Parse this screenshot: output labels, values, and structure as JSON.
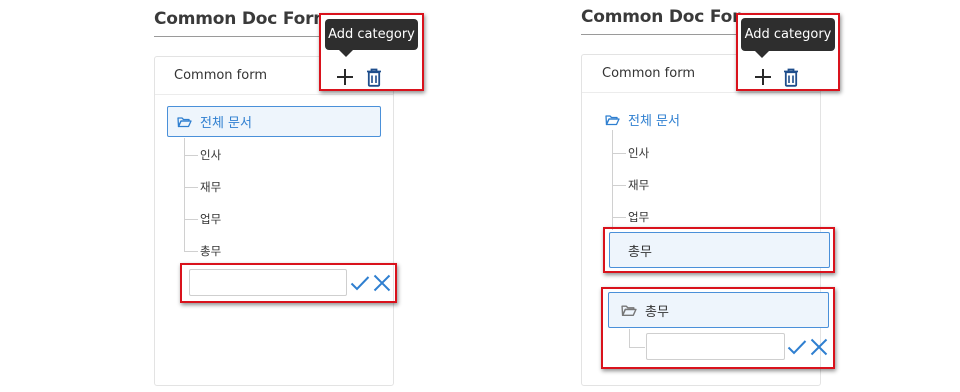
{
  "colors": {
    "accent": "#2f7fd0",
    "highlight": "#d9121c",
    "tooltip_bg": "#2e2e2e",
    "selected_bg": "#eef5fc"
  },
  "left": {
    "page_title": "Common Doc Form Mana",
    "panel_title": "Common form",
    "tooltip": "Add category",
    "actions": {
      "add_icon": "plus-icon",
      "delete_icon": "trash-icon"
    },
    "tree": {
      "root": {
        "icon": "folder-open-icon",
        "label": "전체 문서"
      },
      "items": [
        "인사",
        "재무",
        "업무",
        "총무"
      ]
    },
    "new_category_input": {
      "value": "",
      "placeholder": ""
    },
    "confirm_icon": "check-icon",
    "cancel_icon": "close-icon"
  },
  "right": {
    "page_title": "Common Doc Form Mana",
    "panel_title": "Common form",
    "tooltip": "Add category",
    "actions": {
      "add_icon": "plus-icon",
      "delete_icon": "trash-icon"
    },
    "tree": {
      "root": {
        "icon": "folder-open-icon",
        "label": "전체 문서"
      },
      "items": [
        "인사",
        "재무",
        "업무"
      ]
    },
    "selected_item": "총무",
    "selected_folder": {
      "icon": "folder-open-icon",
      "label": "총무"
    },
    "new_category_input": {
      "value": "",
      "placeholder": ""
    },
    "confirm_icon": "check-icon",
    "cancel_icon": "close-icon"
  }
}
